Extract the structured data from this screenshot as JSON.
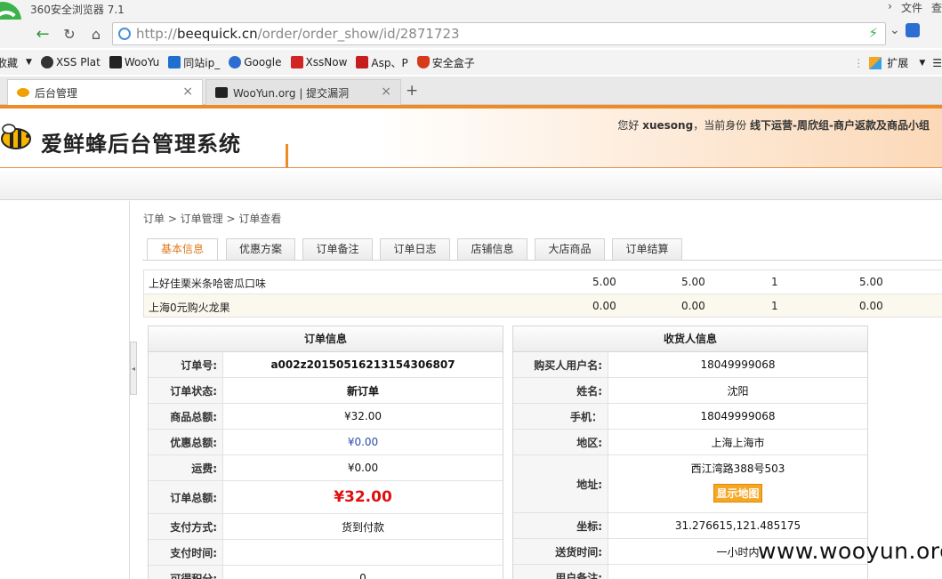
{
  "browser": {
    "title": "360安全浏览器 7.1",
    "menu_file": "文件",
    "menu_view": "查",
    "url_prefix": "http://",
    "url_domain": "beequick.cn",
    "url_path": "/order/order_show/id/2871723",
    "bookmarks": [
      "收藏",
      "XSS Plat",
      "WooYu",
      "同站ip_",
      "Google",
      "XssNow",
      "Asp、P",
      "安全盒子"
    ],
    "bookmark_icon_colors": [
      "#555555",
      "#333333",
      "#222222",
      "#1e6fd0",
      "#2d6fd1",
      "#d12424",
      "#c41e1e",
      "#d63a1a"
    ],
    "ext_label": "扩展",
    "tabs": [
      {
        "label": "后台管理"
      },
      {
        "label": "WooYun.org | 提交漏洞"
      }
    ]
  },
  "header": {
    "system_title": "爱鲜蜂后台管理系统",
    "greeting_prefix": "您好",
    "username": "xuesong",
    "role_prefix": "，当前身份",
    "role": "线下运营-周欣组-商户返款及商品小组"
  },
  "breadcrumb": "订单 > 订单管理 > 订单查看",
  "page_tabs": [
    "基本信息",
    "优惠方案",
    "订单备注",
    "订单日志",
    "店铺信息",
    "大店商品",
    "订单结算"
  ],
  "goods": [
    {
      "name": "上好佳栗米条哈密瓜口味",
      "price": "5.00",
      "pay": "5.00",
      "qty": "1",
      "total": "5.00"
    },
    {
      "name": "上海0元购火龙果",
      "price": "0.00",
      "pay": "0.00",
      "qty": "1",
      "total": "0.00"
    }
  ],
  "order_info": {
    "title": "订单信息",
    "rows": [
      {
        "label": "订单号:",
        "value": "a002z20150516213154306807"
      },
      {
        "label": "订单状态:",
        "value": "新订单"
      },
      {
        "label": "商品总额:",
        "value": "¥32.00"
      },
      {
        "label": "优惠总额:",
        "value": "¥0.00"
      },
      {
        "label": "运费:",
        "value": "¥0.00"
      },
      {
        "label": "订单总额:",
        "value": "¥32.00"
      },
      {
        "label": "支付方式:",
        "value": "货到付款"
      },
      {
        "label": "支付时间:",
        "value": ""
      },
      {
        "label": "可得积分:",
        "value": "0"
      }
    ]
  },
  "receiver_info": {
    "title": "收货人信息",
    "rows": [
      {
        "label": "购买人用户名:",
        "value": "18049999068"
      },
      {
        "label": "姓名:",
        "value": "沈阳"
      },
      {
        "label": "手机：",
        "value": "18049999068"
      },
      {
        "label": "地区:",
        "value": "上海上海市"
      },
      {
        "label": "地址:",
        "value": "西江湾路388号503"
      },
      {
        "label": "坐标:",
        "value": "31.276615,121.485175"
      },
      {
        "label": "送货时间:",
        "value": "一小时内"
      },
      {
        "label": "用户备注:",
        "value": ""
      }
    ],
    "map_button": "显示地图"
  },
  "watermark": "www.wooyun.org"
}
